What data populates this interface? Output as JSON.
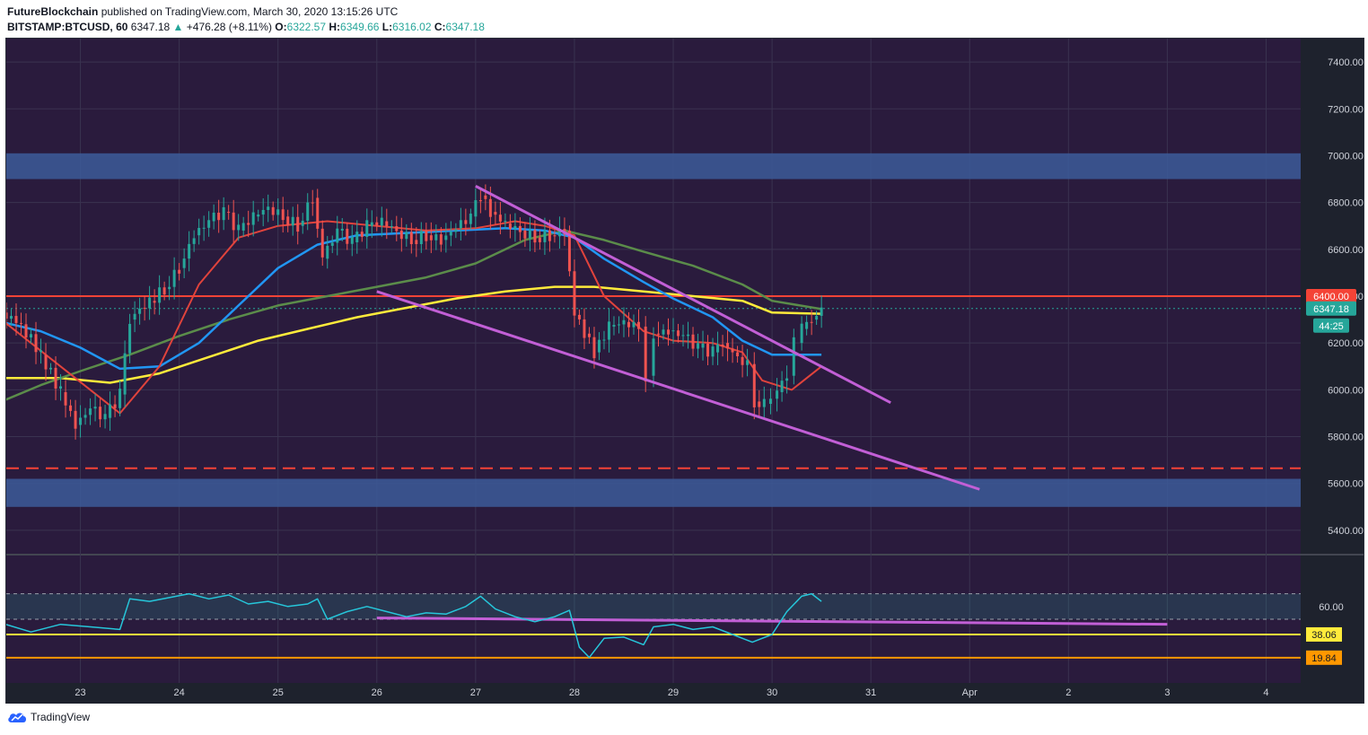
{
  "header": {
    "author": "FutureBlockchain",
    "published_text": "published on TradingView.com, March 30, 2020 13:15:26 UTC",
    "symbol": "BITSTAMP:BTCUSD, 60",
    "last": "6347.18",
    "change_arrow": "▲",
    "change": "+476.28 (+8.11%)",
    "o_label": "O:",
    "o_value": "6322.57",
    "h_label": "H:",
    "h_value": "6349.66",
    "l_label": "L:",
    "l_value": "6316.02",
    "c_label": "C:",
    "c_value": "6347.18"
  },
  "footer": {
    "brand": "TradingView"
  },
  "colors": {
    "bg": "#2a1b3d",
    "zone": "#3c5a99",
    "candle_up": "#26a69a",
    "candle_down": "#ef5350",
    "ma_fast": "#e0433c",
    "ma_blue": "#2196f3",
    "ma_green": "#5b8c4a",
    "ma_yellow": "#ffeb3b",
    "trendline": "#c25fd6",
    "resistance": "#f44336",
    "rsi": "#26c6da",
    "rsi_upper_level": "#ffeb3b",
    "rsi_lower_level": "#ff9800"
  },
  "chart_data": {
    "type": "candlestick",
    "symbol": "BITSTAMP:BTCUSD",
    "interval": "60",
    "price_axis": {
      "ylim": [
        5300,
        7500
      ],
      "ticks": [
        "7400.00",
        "7200.00",
        "7000.00",
        "6800.00",
        "6600.00",
        "6400.00",
        "6200.00",
        "6000.00",
        "5800.00",
        "5600.00",
        "5400.00"
      ]
    },
    "x_axis": {
      "ticks": [
        "23",
        "24",
        "25",
        "26",
        "27",
        "28",
        "29",
        "30",
        "31",
        "Apr",
        "2",
        "3",
        "4"
      ]
    },
    "price_labels": {
      "resistance": "6400.00",
      "last": "6347.18",
      "countdown": "44:25"
    },
    "zones": [
      {
        "name": "upper-zone",
        "from": 6900,
        "to": 7010
      },
      {
        "name": "lower-zone",
        "from": 5500,
        "to": 5620
      }
    ],
    "horizontal_lines": [
      {
        "name": "resistance",
        "value": 6400,
        "style": "solid"
      },
      {
        "name": "support-dashed",
        "value": 5665,
        "style": "dashed"
      }
    ],
    "trendlines": [
      {
        "name": "upper-channel",
        "from": [
          27.0,
          6870
        ],
        "to": [
          31.2,
          5945
        ]
      },
      {
        "name": "lower-channel",
        "from": [
          26.0,
          6420
        ],
        "to": [
          32.1,
          5575
        ]
      }
    ],
    "moving_averages": {
      "fast_red": [
        [
          22.2,
          6300
        ],
        [
          22.8,
          6100
        ],
        [
          23.4,
          5900
        ],
        [
          23.8,
          6100
        ],
        [
          24.2,
          6450
        ],
        [
          24.6,
          6650
        ],
        [
          25.0,
          6700
        ],
        [
          25.5,
          6720
        ],
        [
          26.0,
          6700
        ],
        [
          26.5,
          6680
        ],
        [
          27.0,
          6690
        ],
        [
          27.4,
          6720
        ],
        [
          27.7,
          6700
        ],
        [
          28.0,
          6660
        ],
        [
          28.3,
          6400
        ],
        [
          28.7,
          6250
        ],
        [
          29.0,
          6210
        ],
        [
          29.4,
          6200
        ],
        [
          29.7,
          6160
        ],
        [
          29.9,
          6040
        ],
        [
          30.2,
          6000
        ],
        [
          30.5,
          6100
        ]
      ],
      "blue": [
        [
          22.2,
          6290
        ],
        [
          22.6,
          6250
        ],
        [
          23.0,
          6180
        ],
        [
          23.4,
          6090
        ],
        [
          23.8,
          6100
        ],
        [
          24.2,
          6200
        ],
        [
          24.6,
          6360
        ],
        [
          25.0,
          6520
        ],
        [
          25.4,
          6620
        ],
        [
          25.8,
          6660
        ],
        [
          26.3,
          6670
        ],
        [
          26.8,
          6680
        ],
        [
          27.3,
          6690
        ],
        [
          27.7,
          6680
        ],
        [
          28.0,
          6650
        ],
        [
          28.3,
          6560
        ],
        [
          28.7,
          6460
        ],
        [
          29.0,
          6390
        ],
        [
          29.4,
          6310
        ],
        [
          29.7,
          6210
        ],
        [
          30.0,
          6150
        ],
        [
          30.5,
          6150
        ]
      ],
      "green": [
        [
          22.2,
          5950
        ],
        [
          22.6,
          6020
        ],
        [
          23.0,
          6080
        ],
        [
          23.5,
          6150
        ],
        [
          24.0,
          6230
        ],
        [
          24.5,
          6300
        ],
        [
          25.0,
          6360
        ],
        [
          25.5,
          6400
        ],
        [
          26.0,
          6440
        ],
        [
          26.5,
          6480
        ],
        [
          27.0,
          6540
        ],
        [
          27.5,
          6640
        ],
        [
          27.9,
          6680
        ],
        [
          28.3,
          6640
        ],
        [
          28.7,
          6590
        ],
        [
          29.2,
          6530
        ],
        [
          29.7,
          6450
        ],
        [
          30.0,
          6380
        ],
        [
          30.5,
          6345
        ]
      ],
      "yellow": [
        [
          22.2,
          6050
        ],
        [
          22.8,
          6050
        ],
        [
          23.3,
          6030
        ],
        [
          23.8,
          6070
        ],
        [
          24.3,
          6140
        ],
        [
          24.8,
          6210
        ],
        [
          25.3,
          6260
        ],
        [
          25.8,
          6310
        ],
        [
          26.3,
          6350
        ],
        [
          26.8,
          6390
        ],
        [
          27.3,
          6420
        ],
        [
          27.8,
          6440
        ],
        [
          28.2,
          6440
        ],
        [
          28.7,
          6420
        ],
        [
          29.2,
          6400
        ],
        [
          29.7,
          6380
        ],
        [
          30.0,
          6330
        ],
        [
          30.5,
          6325
        ]
      ]
    },
    "candles_close": [
      [
        22.2,
        6330
      ],
      [
        22.4,
        6280
      ],
      [
        22.6,
        6150
      ],
      [
        22.8,
        5990
      ],
      [
        22.95,
        5850
      ],
      [
        23.1,
        5920
      ],
      [
        23.25,
        5880
      ],
      [
        23.4,
        5980
      ],
      [
        23.5,
        6300
      ],
      [
        23.6,
        6350
      ],
      [
        23.7,
        6380
      ],
      [
        23.85,
        6430
      ],
      [
        24.0,
        6520
      ],
      [
        24.15,
        6660
      ],
      [
        24.3,
        6720
      ],
      [
        24.45,
        6760
      ],
      [
        24.6,
        6680
      ],
      [
        24.75,
        6740
      ],
      [
        24.9,
        6780
      ],
      [
        25.05,
        6740
      ],
      [
        25.2,
        6700
      ],
      [
        25.35,
        6820
      ],
      [
        25.45,
        6560
      ],
      [
        25.6,
        6680
      ],
      [
        25.75,
        6630
      ],
      [
        25.9,
        6700
      ],
      [
        26.05,
        6720
      ],
      [
        26.2,
        6680
      ],
      [
        26.35,
        6640
      ],
      [
        26.5,
        6660
      ],
      [
        26.65,
        6640
      ],
      [
        26.8,
        6690
      ],
      [
        26.95,
        6740
      ],
      [
        27.05,
        6830
      ],
      [
        27.15,
        6760
      ],
      [
        27.3,
        6710
      ],
      [
        27.45,
        6680
      ],
      [
        27.6,
        6650
      ],
      [
        27.75,
        6660
      ],
      [
        27.9,
        6680
      ],
      [
        28.0,
        6320
      ],
      [
        28.1,
        6240
      ],
      [
        28.2,
        6160
      ],
      [
        28.35,
        6270
      ],
      [
        28.5,
        6290
      ],
      [
        28.65,
        6270
      ],
      [
        28.72,
        6060
      ],
      [
        28.8,
        6240
      ],
      [
        28.95,
        6250
      ],
      [
        29.1,
        6230
      ],
      [
        29.25,
        6180
      ],
      [
        29.4,
        6160
      ],
      [
        29.5,
        6200
      ],
      [
        29.65,
        6140
      ],
      [
        29.75,
        6110
      ],
      [
        29.82,
        5950
      ],
      [
        29.92,
        5940
      ],
      [
        30.05,
        5990
      ],
      [
        30.15,
        6060
      ],
      [
        30.22,
        6200
      ],
      [
        30.3,
        6260
      ],
      [
        30.4,
        6300
      ],
      [
        30.5,
        6347
      ]
    ],
    "rsi": {
      "ylim": [
        0,
        100
      ],
      "ticks": [
        "60.00"
      ],
      "levels": [
        {
          "name": "upper-level",
          "value": 38.06,
          "label": "38.06"
        },
        {
          "name": "lower-level",
          "value": 19.84,
          "label": "19.84"
        }
      ],
      "band": [
        50,
        70
      ],
      "values": [
        [
          22.2,
          47
        ],
        [
          22.5,
          40
        ],
        [
          22.8,
          46
        ],
        [
          23.1,
          44
        ],
        [
          23.4,
          42
        ],
        [
          23.5,
          66
        ],
        [
          23.7,
          64
        ],
        [
          23.9,
          67
        ],
        [
          24.1,
          70
        ],
        [
          24.3,
          66
        ],
        [
          24.5,
          69
        ],
        [
          24.7,
          62
        ],
        [
          24.9,
          64
        ],
        [
          25.1,
          60
        ],
        [
          25.3,
          62
        ],
        [
          25.4,
          66
        ],
        [
          25.5,
          50
        ],
        [
          25.7,
          56
        ],
        [
          25.9,
          60
        ],
        [
          26.1,
          56
        ],
        [
          26.3,
          52
        ],
        [
          26.5,
          55
        ],
        [
          26.7,
          54
        ],
        [
          26.9,
          60
        ],
        [
          27.05,
          68
        ],
        [
          27.2,
          58
        ],
        [
          27.4,
          52
        ],
        [
          27.6,
          48
        ],
        [
          27.8,
          52
        ],
        [
          27.95,
          57
        ],
        [
          28.05,
          28
        ],
        [
          28.15,
          20
        ],
        [
          28.3,
          35
        ],
        [
          28.5,
          36
        ],
        [
          28.7,
          30
        ],
        [
          28.8,
          44
        ],
        [
          29.0,
          46
        ],
        [
          29.2,
          42
        ],
        [
          29.4,
          44
        ],
        [
          29.6,
          38
        ],
        [
          29.8,
          32
        ],
        [
          30.0,
          38
        ],
        [
          30.15,
          56
        ],
        [
          30.3,
          68
        ],
        [
          30.4,
          70
        ],
        [
          30.5,
          64
        ]
      ],
      "trendline": {
        "from": [
          26.0,
          51
        ],
        "to": [
          34.0,
          46
        ]
      }
    }
  }
}
